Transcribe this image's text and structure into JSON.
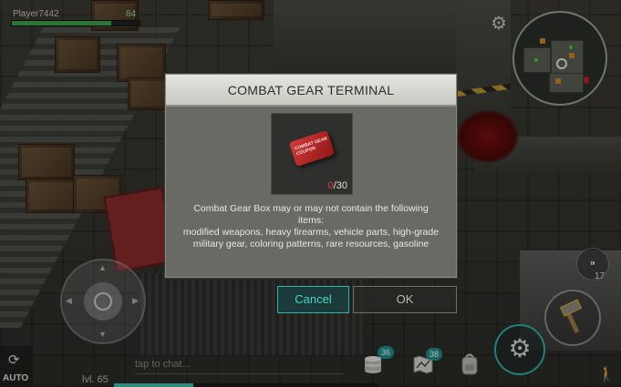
{
  "hud": {
    "player_name": "Player7442",
    "health_value": "84",
    "health_fraction": 0.78,
    "level_label": "lvl. 65",
    "chat_placeholder": "tap to chat...",
    "auto_label": "AUTO",
    "xp_fraction": 0.3,
    "badges": {
      "coins": "36",
      "map": "38"
    },
    "ammo_count": "17",
    "icons": [
      "settings-gear-icon",
      "minimap",
      "joystick",
      "auto-refresh-icon",
      "coin-stack-icon",
      "map-icon",
      "backpack-icon",
      "crafting-gear-icon",
      "hammer-weapon-icon",
      "ammo-icon",
      "sneak-icon"
    ]
  },
  "dialog": {
    "title": "COMBAT GEAR TERMINAL",
    "item": {
      "icon": "combat-gear-coupon-icon",
      "coupon_text": "COMBAT GEAR COUPON",
      "current": "0",
      "required": "/30"
    },
    "description_line1": "Combat Gear Box may or may not contain the following items:",
    "description_line2": "modified weapons, heavy firearms, vehicle parts, high-grade military gear, coloring patterns, rare resources, gasoline",
    "cancel_label": "Cancel",
    "ok_label": "OK"
  },
  "colors": {
    "accent": "#2fb6ab",
    "health": "#3fa34a",
    "warning_count": "#e04040"
  }
}
